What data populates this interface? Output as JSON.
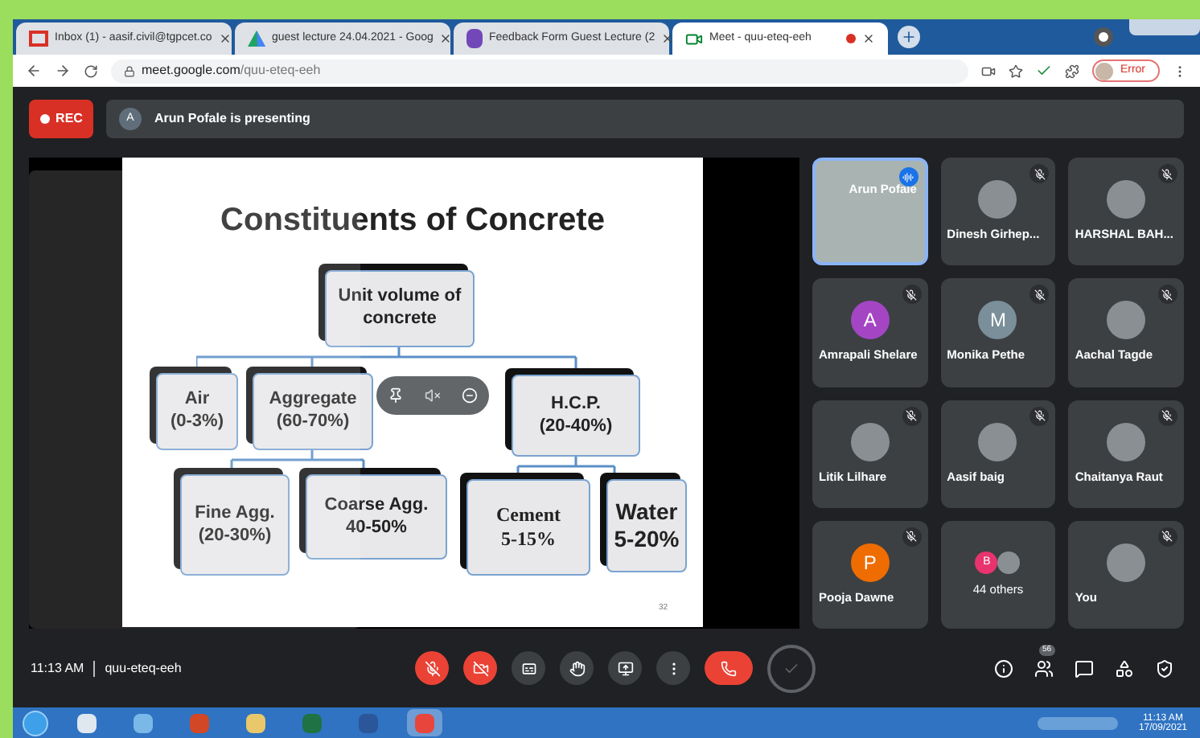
{
  "browser": {
    "tabs": [
      {
        "kind": "gmail",
        "title": "Inbox (1) - aasif.civil@tgpcet.co",
        "selected": false
      },
      {
        "kind": "drive",
        "title": "guest lecture 24.04.2021 - Goog",
        "selected": false
      },
      {
        "kind": "forms",
        "title": "Feedback Form Guest Lecture (2",
        "selected": false
      },
      {
        "kind": "meet",
        "title": "Meet - quu-eteq-eeh",
        "selected": true,
        "recording": true
      }
    ],
    "url_host": "meet.google.com",
    "url_path": "/quu-eteq-eeh",
    "profile_label": "Error"
  },
  "meeting": {
    "rec_label": "REC",
    "presenter_initial": "A",
    "presenting_text": "Arun Pofale is presenting",
    "slide": {
      "title": "Constituents of Concrete",
      "page": "32",
      "nodes": [
        {
          "kind": "root",
          "lines": [
            "Unit volume of",
            "concrete"
          ]
        },
        {
          "kind": "level1",
          "lines": [
            "Air",
            "(0-3%)"
          ]
        },
        {
          "kind": "level1",
          "lines": [
            "Aggregate",
            "(60-70%)"
          ]
        },
        {
          "kind": "level1",
          "lines": [
            "H.C.P.",
            "(20-40%)"
          ]
        },
        {
          "kind": "level2",
          "lines": [
            "Fine Agg.",
            "(20-30%)"
          ]
        },
        {
          "kind": "level2",
          "lines": [
            "Coarse Agg.",
            "40-50%"
          ]
        },
        {
          "kind": "serif",
          "lines": [
            "Cement",
            "5-15%"
          ]
        },
        {
          "kind": "large",
          "lines": [
            "Water",
            "5-20%"
          ]
        }
      ]
    },
    "participants": [
      {
        "kind": "video",
        "name": "Arun Pofale",
        "speaking": true,
        "muted": false
      },
      {
        "kind": "photo",
        "name": "Dinesh Girhep...",
        "speaking": false,
        "muted": true
      },
      {
        "kind": "photo",
        "name": "HARSHAL BAH...",
        "speaking": false,
        "muted": true
      },
      {
        "kind": "letter",
        "initial": "A",
        "color": "#a445c4",
        "name": "Amrapali Shelare",
        "speaking": false,
        "muted": true
      },
      {
        "kind": "letter",
        "initial": "M",
        "color": "#7a8f99",
        "name": "Monika Pethe",
        "speaking": false,
        "muted": true
      },
      {
        "kind": "photo",
        "name": "Aachal Tagde",
        "speaking": false,
        "muted": true
      },
      {
        "kind": "photo",
        "name": "Litik Lilhare",
        "speaking": false,
        "muted": true
      },
      {
        "kind": "photo",
        "name": "Aasif baig",
        "speaking": false,
        "muted": true
      },
      {
        "kind": "photo",
        "name": "Chaitanya Raut",
        "speaking": false,
        "muted": true
      },
      {
        "kind": "letter",
        "initial": "P",
        "color": "#ef6c00",
        "name": "Pooja Dawne",
        "speaking": false,
        "muted": true
      },
      {
        "kind": "others",
        "initial": "B",
        "color": "#e8336e",
        "name": "44 others",
        "speaking": false,
        "muted": false
      },
      {
        "kind": "photo",
        "name": "You",
        "speaking": false,
        "muted": true
      }
    ],
    "time": "11:13 AM",
    "meeting_code": "quu-eteq-eeh",
    "controls": [
      {
        "kind": "mic",
        "off": true
      },
      {
        "kind": "camera",
        "off": true
      },
      {
        "kind": "captions",
        "off": false
      },
      {
        "kind": "hand",
        "off": false
      },
      {
        "kind": "present",
        "off": false
      },
      {
        "kind": "more",
        "off": false
      },
      {
        "kind": "leave"
      },
      {
        "kind": "check"
      }
    ],
    "people_count": "56"
  },
  "taskbar": {
    "apps": [
      {
        "kind": "explorer",
        "selected": false
      },
      {
        "kind": "paint",
        "selected": false
      },
      {
        "kind": "powerpoint",
        "selected": false
      },
      {
        "kind": "folder",
        "selected": false
      },
      {
        "kind": "excel",
        "selected": false
      },
      {
        "kind": "word",
        "selected": false
      },
      {
        "kind": "chrome",
        "selected": true
      }
    ],
    "clock_time": "11:13 AM",
    "clock_date": "17/09/2021"
  }
}
